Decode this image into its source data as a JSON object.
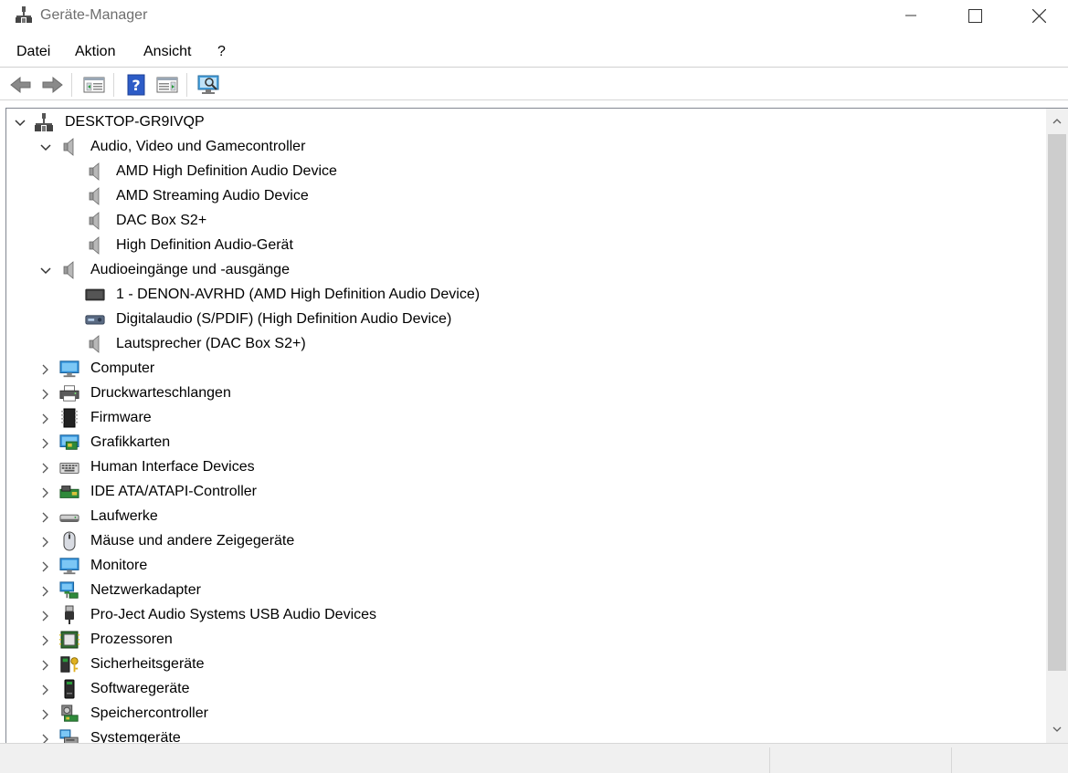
{
  "window": {
    "title": "Geräte-Manager",
    "icon": "device-manager-icon"
  },
  "menu": [
    "Datei",
    "Aktion",
    "Ansicht",
    "?"
  ],
  "toolbar": [
    "back-arrow-icon",
    "forward-arrow-icon",
    "properties-view-icon",
    "help-icon",
    "action-pane-icon",
    "scan-hardware-icon"
  ],
  "tree": {
    "root": "DESKTOP-GR9IVQP",
    "categories": [
      {
        "label": "Audio, Video und Gamecontroller",
        "icon": "speaker-icon",
        "expanded": true,
        "children": [
          {
            "label": "AMD High Definition Audio Device",
            "icon": "speaker-icon"
          },
          {
            "label": "AMD Streaming Audio Device",
            "icon": "speaker-icon"
          },
          {
            "label": "DAC Box S2+",
            "icon": "speaker-icon"
          },
          {
            "label": "High Definition Audio-Gerät",
            "icon": "speaker-icon"
          }
        ]
      },
      {
        "label": "Audioeingänge und -ausgänge",
        "icon": "speaker-icon",
        "expanded": true,
        "children": [
          {
            "label": "1 - DENON-AVRHD (AMD High Definition Audio Device)",
            "icon": "display-icon"
          },
          {
            "label": "Digitalaudio (S/PDIF) (High Definition Audio Device)",
            "icon": "receiver-icon"
          },
          {
            "label": "Lautsprecher (DAC Box S2+)",
            "icon": "speaker-icon"
          }
        ]
      },
      {
        "label": "Computer",
        "icon": "computer-icon",
        "expanded": false
      },
      {
        "label": "Druckwarteschlangen",
        "icon": "printer-icon",
        "expanded": false
      },
      {
        "label": "Firmware",
        "icon": "firmware-chip-icon",
        "expanded": false
      },
      {
        "label": "Grafikkarten",
        "icon": "graphics-card-icon",
        "expanded": false
      },
      {
        "label": "Human Interface Devices",
        "icon": "keyboard-icon",
        "expanded": false
      },
      {
        "label": "IDE ATA/ATAPI-Controller",
        "icon": "ide-controller-icon",
        "expanded": false
      },
      {
        "label": "Laufwerke",
        "icon": "disk-drive-icon",
        "expanded": false
      },
      {
        "label": "Mäuse und andere Zeigegeräte",
        "icon": "mouse-icon",
        "expanded": false
      },
      {
        "label": "Monitore",
        "icon": "monitor-icon",
        "expanded": false
      },
      {
        "label": "Netzwerkadapter",
        "icon": "network-adapter-icon",
        "expanded": false
      },
      {
        "label": "Pro-Ject Audio Systems USB Audio Devices",
        "icon": "usb-plug-icon",
        "expanded": false
      },
      {
        "label": "Prozessoren",
        "icon": "processor-icon",
        "expanded": false
      },
      {
        "label": "Sicherheitsgeräte",
        "icon": "security-key-icon",
        "expanded": false
      },
      {
        "label": "Softwaregeräte",
        "icon": "software-device-icon",
        "expanded": false
      },
      {
        "label": "Speichercontroller",
        "icon": "storage-controller-icon",
        "expanded": false
      },
      {
        "label": "Systemgeräte",
        "icon": "system-devices-icon",
        "expanded": false
      }
    ]
  }
}
